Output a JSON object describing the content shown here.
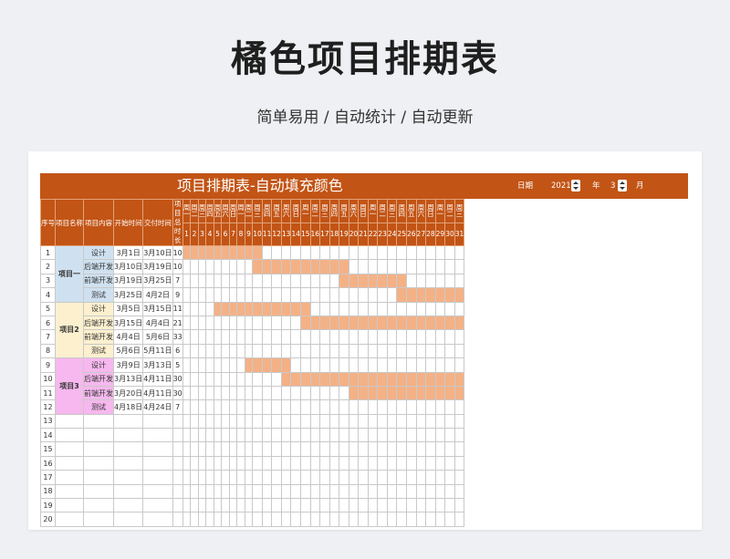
{
  "hero": {
    "title": "橘色项目排期表",
    "subtitle": "简单易用 / 自动统计 / 自动更新"
  },
  "sheet": {
    "title": "项目排期表-自动填充颜色",
    "date_label": "日期",
    "year": "2021",
    "year_unit": "年",
    "month": "3",
    "month_unit": "月",
    "colors": {
      "header": "#c25415",
      "bar": "#f4b186"
    },
    "headers": {
      "no": "序号",
      "project": "项目名称",
      "content": "项目内容",
      "start": "开始时间",
      "end": "交付时间",
      "duration": "项目总时长"
    },
    "weekdays": [
      "一",
      "二",
      "三",
      "四",
      "五",
      "六",
      "日",
      "一",
      "二",
      "三",
      "四",
      "五",
      "六",
      "日",
      "一",
      "二",
      "三",
      "四",
      "五",
      "六",
      "日",
      "一",
      "二",
      "三",
      "四",
      "五",
      "六",
      "日",
      "一",
      "二",
      "三"
    ],
    "weekday_prefix": "周",
    "days": [
      "1",
      "2",
      "3",
      "4",
      "5",
      "6",
      "7",
      "8",
      "9",
      "10",
      "11",
      "12",
      "13",
      "14",
      "15",
      "16",
      "17",
      "18",
      "19",
      "20",
      "21",
      "22",
      "23",
      "24",
      "25",
      "26",
      "27",
      "28",
      "29",
      "30",
      "31"
    ],
    "projects": [
      {
        "name": "项目一",
        "tasks": [
          {
            "no": "1",
            "content": "设计",
            "start": "3月1日",
            "end": "3月10日",
            "duration": "10",
            "from": 1,
            "to": 10
          },
          {
            "no": "2",
            "content": "后端开发",
            "start": "3月10日",
            "end": "3月19日",
            "duration": "10",
            "from": 10,
            "to": 19
          },
          {
            "no": "3",
            "content": "前端开发",
            "start": "3月19日",
            "end": "3月25日",
            "duration": "7",
            "from": 19,
            "to": 25
          },
          {
            "no": "4",
            "content": "测试",
            "start": "3月25日",
            "end": "4月2日",
            "duration": "9",
            "from": 25,
            "to": 31
          }
        ]
      },
      {
        "name": "项目2",
        "tasks": [
          {
            "no": "5",
            "content": "设计",
            "start": "3月5日",
            "end": "3月15日",
            "duration": "11",
            "from": 5,
            "to": 15
          },
          {
            "no": "6",
            "content": "后端开发",
            "start": "3月15日",
            "end": "4月4日",
            "duration": "21",
            "from": 15,
            "to": 31
          },
          {
            "no": "7",
            "content": "前端开发",
            "start": "4月4日",
            "end": "5月6日",
            "duration": "33",
            "from": 0,
            "to": 0
          },
          {
            "no": "8",
            "content": "测试",
            "start": "5月6日",
            "end": "5月11日",
            "duration": "6",
            "from": 0,
            "to": 0
          }
        ]
      },
      {
        "name": "项目3",
        "tasks": [
          {
            "no": "9",
            "content": "设计",
            "start": "3月9日",
            "end": "3月13日",
            "duration": "5",
            "from": 9,
            "to": 13
          },
          {
            "no": "10",
            "content": "后端开发",
            "start": "3月13日",
            "end": "4月11日",
            "duration": "30",
            "from": 13,
            "to": 31
          },
          {
            "no": "11",
            "content": "前端开发",
            "start": "3月20日",
            "end": "4月11日",
            "duration": "30",
            "from": 20,
            "to": 31
          },
          {
            "no": "12",
            "content": "测试",
            "start": "4月18日",
            "end": "4月24日",
            "duration": "7",
            "from": 0,
            "to": 0
          }
        ]
      }
    ],
    "empty_rows": [
      "13",
      "14",
      "15",
      "16",
      "17",
      "18",
      "19",
      "20"
    ]
  }
}
